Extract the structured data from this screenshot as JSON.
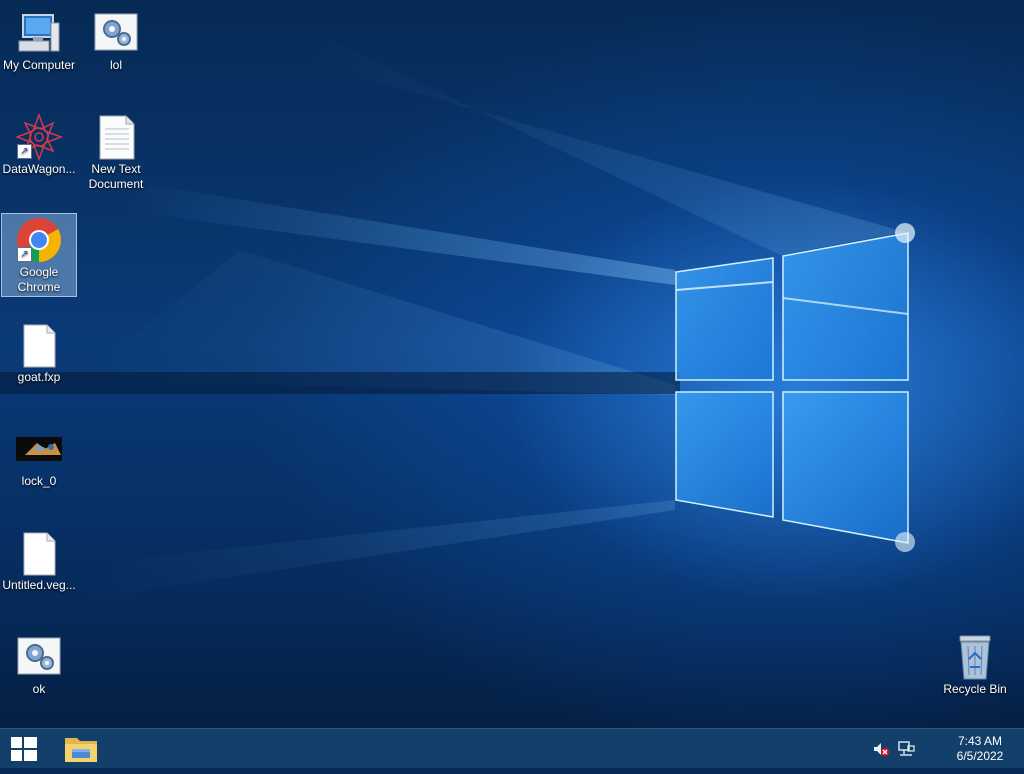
{
  "desktop": {
    "icons": [
      {
        "label": "My Computer",
        "icon": "computer-icon"
      },
      {
        "label": "lol",
        "icon": "settings-file-icon"
      },
      {
        "label": "DataWagon...",
        "icon": "datawagon-icon"
      },
      {
        "label": "New Text Document",
        "icon": "text-document-icon"
      },
      {
        "label": "Google Chrome",
        "icon": "chrome-icon",
        "selected": true
      },
      {
        "label": "goat.fxp",
        "icon": "blank-file-icon"
      },
      {
        "label": "lock_0",
        "icon": "image-thumbnail-icon"
      },
      {
        "label": "Untitled.veg...",
        "icon": "blank-file-icon"
      },
      {
        "label": "ok",
        "icon": "settings-file-icon"
      },
      {
        "label": "Recycle Bin",
        "icon": "recycle-bin-icon"
      }
    ]
  },
  "taskbar": {
    "start_icon": "windows-logo-icon",
    "pinned": [
      {
        "icon": "file-explorer-icon"
      }
    ],
    "tray": {
      "icons": [
        "speaker-muted-icon",
        "network-icon"
      ]
    },
    "clock": {
      "time": "7:43 AM",
      "date": "6/5/2022"
    }
  },
  "colors": {
    "accent": "#0078d7",
    "taskbar": "#12406a"
  }
}
